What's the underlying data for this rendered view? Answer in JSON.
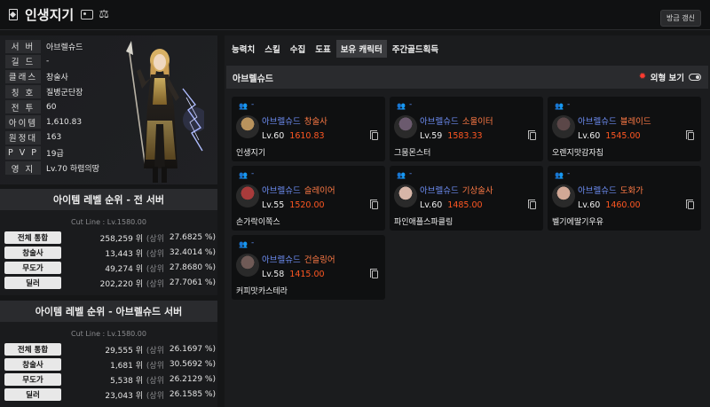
{
  "header": {
    "title": "인생지기",
    "refresh_label": "방금 갱신"
  },
  "profile": {
    "stats": [
      {
        "key": "서 버",
        "value": "아브렐슈드"
      },
      {
        "key": "길 드",
        "value": "-"
      },
      {
        "key": "클래스",
        "value": "창술사"
      },
      {
        "key": "칭 호",
        "value": "질병군단장"
      },
      {
        "key": "전 투",
        "value": "60"
      },
      {
        "key": "아이템",
        "value": "1,610.83"
      },
      {
        "key": "원정대",
        "value": "163"
      },
      {
        "key": "P V P",
        "value": "19급"
      },
      {
        "key": "영 지",
        "value": "Lv.70 하렴의땅"
      }
    ]
  },
  "rank_all": {
    "title": "아이템 레벨 순위 - 전 서버",
    "cutline": "Cut Line : Lv.1580.00",
    "rows": [
      {
        "label": "전체 통합",
        "rank": "258,259 위",
        "sub": "(상위",
        "pct": "27.6825 %)"
      },
      {
        "label": "창술사",
        "rank": "13,443 위",
        "sub": "(상위",
        "pct": "32.4014 %)"
      },
      {
        "label": "무도가",
        "rank": "49,274 위",
        "sub": "(상위",
        "pct": "27.8680 %)"
      },
      {
        "label": "딜러",
        "rank": "202,220 위",
        "sub": "(상위",
        "pct": "27.7061 %)"
      }
    ]
  },
  "rank_server": {
    "title": "아이템 레벨 순위 - 아브렐슈드 서버",
    "cutline": "Cut Line : Lv.1580.00",
    "rows": [
      {
        "label": "전체 통합",
        "rank": "29,555 위",
        "sub": "(상위",
        "pct": "26.1697 %)"
      },
      {
        "label": "창술사",
        "rank": "1,681 위",
        "sub": "(상위",
        "pct": "30.5692 %)"
      },
      {
        "label": "무도가",
        "rank": "5,538 위",
        "sub": "(상위",
        "pct": "26.2129 %)"
      },
      {
        "label": "딜러",
        "rank": "23,043 위",
        "sub": "(상위",
        "pct": "26.1585 %)"
      }
    ]
  },
  "tabs": [
    "능력치",
    "스킬",
    "수집",
    "도표",
    "보유 캐릭터",
    "주간골드획득"
  ],
  "active_tab": "보유 캐릭터",
  "roster": {
    "server": "아브렐슈드",
    "view_label": "외형 보기",
    "characters": [
      {
        "group": "-",
        "server": "아브렐슈드",
        "class": "창술사",
        "level": "Lv.60",
        "ilvl": "1610.83",
        "name": "인생지기",
        "tone": "#b9935d"
      },
      {
        "group": "-",
        "server": "아브렐슈드",
        "class": "소울이터",
        "level": "Lv.59",
        "ilvl": "1583.33",
        "name": "그뭄몬스터",
        "tone": "#6b5a6e"
      },
      {
        "group": "-",
        "server": "아브렐슈드",
        "class": "블레이드",
        "level": "Lv.60",
        "ilvl": "1545.00",
        "name": "오렌지맛감자칩",
        "tone": "#5b4748"
      },
      {
        "group": "-",
        "server": "아브렐슈드",
        "class": "슬레이어",
        "level": "Lv.55",
        "ilvl": "1520.00",
        "name": "손가락이쪽스",
        "tone": "#a83b3b"
      },
      {
        "group": "-",
        "server": "아브렐슈드",
        "class": "기상술사",
        "level": "Lv.60",
        "ilvl": "1485.00",
        "name": "파인애플스파클링",
        "tone": "#d7b6a8"
      },
      {
        "group": "-",
        "server": "아브렐슈드",
        "class": "도화가",
        "level": "Lv.60",
        "ilvl": "1460.00",
        "name": "벨기에딸기우유",
        "tone": "#d2a896"
      },
      {
        "group": "-",
        "server": "아브렐슈드",
        "class": "건슬링어",
        "level": "Lv.58",
        "ilvl": "1415.00",
        "name": "커피맛카스테라",
        "tone": "#6f5a56"
      }
    ]
  }
}
